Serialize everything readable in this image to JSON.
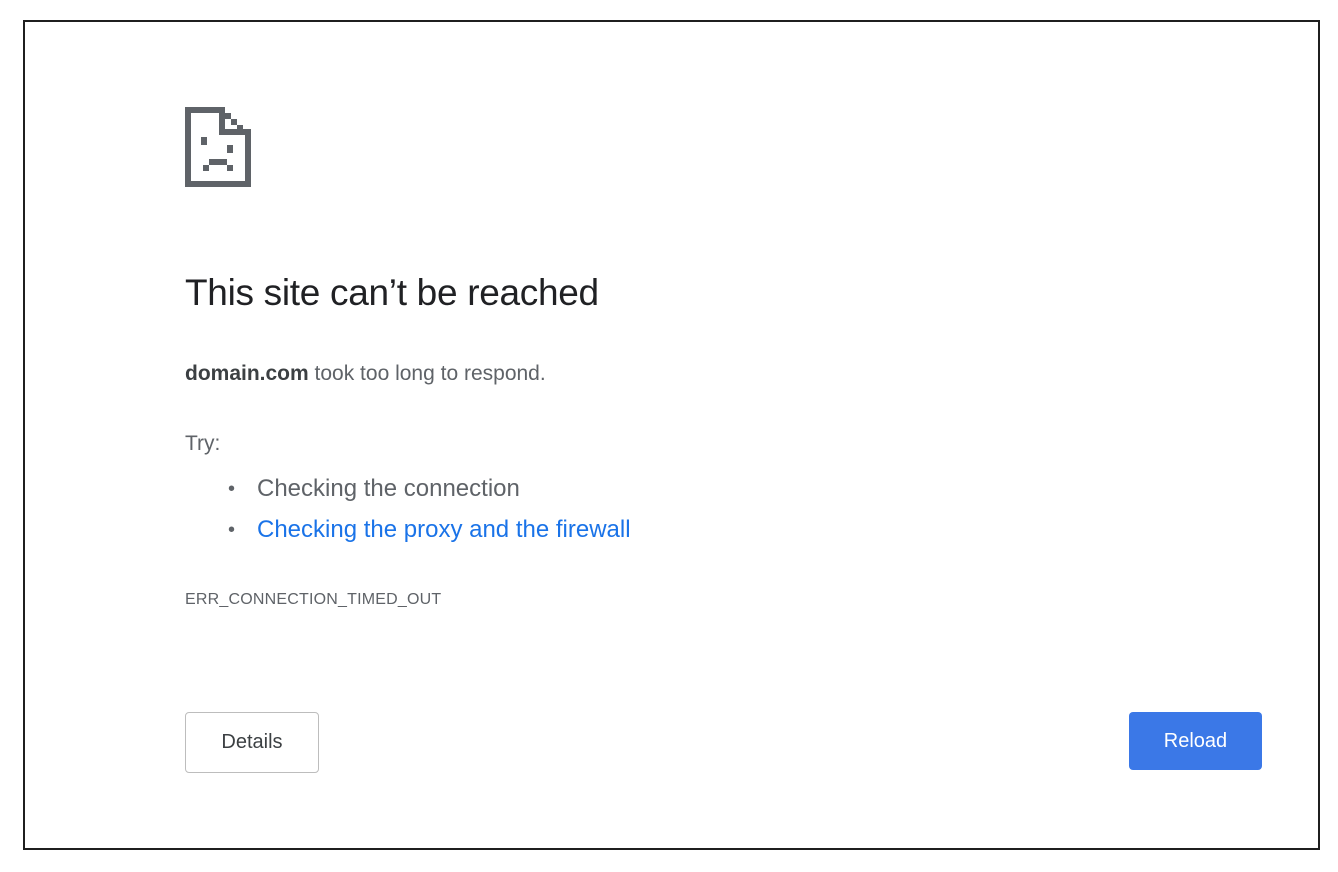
{
  "error_page": {
    "icon": "sad-page-icon",
    "title": "This site can’t be reached",
    "message": {
      "domain": "domain.com",
      "text": " took too long to respond."
    },
    "try_label": "Try:",
    "suggestions": [
      {
        "label": "Checking the connection",
        "is_link": false
      },
      {
        "label": "Checking the proxy and the firewall",
        "is_link": true
      }
    ],
    "error_code": "ERR_CONNECTION_TIMED_OUT",
    "buttons": {
      "details_label": "Details",
      "reload_label": "Reload"
    }
  },
  "colors": {
    "title": "#202124",
    "body_text": "#5f6368",
    "link": "#1a73e8",
    "reload_button": "#3b78e7",
    "frame_border": "#1f1f1f"
  }
}
